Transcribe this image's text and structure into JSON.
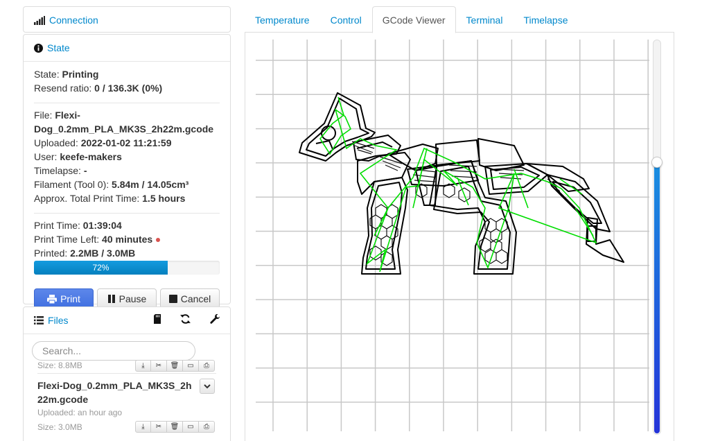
{
  "sidebar": {
    "connection": {
      "title": "Connection",
      "icon": "signal-icon"
    },
    "state": {
      "title": "State",
      "icon": "info-circle-icon",
      "rows": [
        {
          "label": "State:",
          "value": "Printing"
        },
        {
          "label": "Resend ratio:",
          "value": "0 / 136.3K (0%)"
        }
      ],
      "file": {
        "label": "File:",
        "value_line1": "Flexi-",
        "value_line2": "Dog_0.2mm_PLA_MK3S_2h22m.gcode"
      },
      "details": [
        {
          "label": "Uploaded:",
          "value": "2022-01-02 11:21:59"
        },
        {
          "label": "User:",
          "value": "keefe-makers"
        },
        {
          "label": "Timelapse:",
          "value": "-"
        },
        {
          "label": "Filament (Tool 0):",
          "value": "5.84m / 14.05cm³"
        },
        {
          "label": "Approx. Total Print Time:",
          "value": "1.5 hours"
        }
      ],
      "progress_info": [
        {
          "label": "Print Time:",
          "value": "01:39:04"
        },
        {
          "label": "Print Time Left:",
          "value": "40 minutes"
        },
        {
          "label": "Printed:",
          "value": "2.2MB / 3.0MB"
        }
      ],
      "progress": {
        "percent": 72,
        "label": "72%"
      },
      "buttons": {
        "print": "Print",
        "pause": "Pause",
        "cancel": "Cancel"
      }
    },
    "files": {
      "title": "Files",
      "icon": "list-icon",
      "search_placeholder": "Search...",
      "prev_item": {
        "meta": "Size: 8.8MB"
      },
      "item": {
        "name_line1": "Flexi-Dog_0.2mm_PLA_MK3S_2h",
        "name_line2": "22m.gcode",
        "uploaded": "Uploaded: an hour ago",
        "size": "Size: 3.0MB"
      }
    }
  },
  "tabs": [
    {
      "label": "Temperature",
      "active": false
    },
    {
      "label": "Control",
      "active": false
    },
    {
      "label": "GCode Viewer",
      "active": true
    },
    {
      "label": "Terminal",
      "active": false
    },
    {
      "label": "Timelapse",
      "active": false
    }
  ],
  "viewer": {
    "layer_fraction": 0.31,
    "colors": {
      "grid": "#c8c8c8",
      "extrusion": "#000000",
      "travel": "#00dd00",
      "slider_top": "#1a8fe0",
      "slider_bottom": "#2433d8"
    }
  },
  "colors": {
    "link": "#0088cc",
    "primary_button": "#4a78e4",
    "progress": "#0a8dd6",
    "warning_dot": "#d9534f"
  }
}
